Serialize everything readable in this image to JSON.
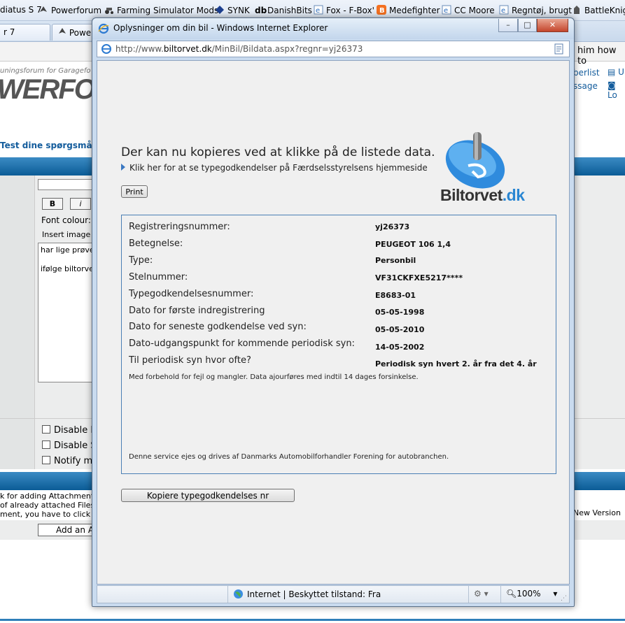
{
  "favorites": [
    {
      "label": "diatus S 7",
      "icon": "page-icon"
    },
    {
      "label": "Powerforum",
      "icon": "forum-icon"
    },
    {
      "label": "Farming Simulator Mods",
      "icon": "tractor-icon"
    },
    {
      "label": "SYNK",
      "icon": "synk-icon"
    },
    {
      "label": "DanishBits",
      "icon": "db-icon"
    },
    {
      "label": "Fox - F-Box'",
      "icon": "ie-icon"
    },
    {
      "label": "Medefighter",
      "icon": "blogger-icon"
    },
    {
      "label": "CC Moore",
      "icon": "ie-icon"
    },
    {
      "label": "Regntøj, brugt",
      "icon": "ie-icon"
    },
    {
      "label": "BattleKnight",
      "icon": "knight-icon"
    }
  ],
  "bg_tabs": [
    {
      "label": "r 7"
    },
    {
      "label": "Powerf"
    }
  ],
  "bg_page": {
    "forum_sub": "uningsforum for Garagefo",
    "logo": "WERFO",
    "memberlist": "berlist",
    "message": "ssage",
    "u_link": "U",
    "lo_link": "Lo",
    "test_link": "Test dine spørgsmål",
    "him_text": "him how to",
    "bold_btn": "B",
    "italic_btn": "i",
    "font_colour": "Font colour:",
    "insert_image": "Insert image",
    "post_line1": "har lige prøve",
    "post_line2": "ifølge biltorve",
    "disable1": "Disable H",
    "disable2": "Disable S",
    "notify": "Notify m",
    "attach1": "k for adding Attachment",
    "attach2": "of already attached Files",
    "attach3": "ment, you have to click",
    "add_btn": "Add an A",
    "new_version": "New Version a"
  },
  "popup": {
    "title": "Oplysninger om din bil - Windows Internet Explorer",
    "url_prefix": "http://www.",
    "url_domain": "biltorvet.dk",
    "url_suffix": "/MinBil/Bildata.aspx?regnr=yj26373",
    "min_btn": "–",
    "max_btn": "□",
    "close_btn": "✕",
    "heading": "Der kan nu kopieres ved at klikke på de listede data.",
    "sublink": "Klik her for at se typegodkendelser på Færdselsstyrelsens hjemmeside",
    "print_label": "Print",
    "logo_main": "Biltorvet",
    "logo_suffix": ".dk",
    "rows": [
      {
        "label": "Registreringsnummer:",
        "value": "yj26373"
      },
      {
        "label": "Betegnelse:",
        "value": "PEUGEOT 106 1,4"
      },
      {
        "label": "Type:",
        "value": "Personbil"
      },
      {
        "label": "Stelnummer:",
        "value": "VF31CKFXE5217****"
      },
      {
        "label": "Typegodkendelsesnummer:",
        "value": "E8683-01"
      },
      {
        "label": "Dato for første indregistrering",
        "value": "05-05-1998"
      },
      {
        "label": "Dato for seneste godkendelse ved syn:",
        "value": "05-05-2010"
      },
      {
        "label": "Dato-udgangspunkt for kommende periodisk syn:",
        "value": "14-05-2002"
      },
      {
        "label": "Til periodisk syn hvor ofte?",
        "value": "Periodisk syn hvert 2. år fra det 4. år"
      }
    ],
    "disclaimer": "Med forbehold for fejl og mangler. Data ajourføres med indtil 14 dages forsinkelse.",
    "footer_note": "Denne service ejes og drives af Danmarks Automobilforhandler Forening for autobranchen.",
    "copy_button": "Kopiere typegodkendelses nr",
    "status_zone": "Internet | Beskyttet tilstand: Fra",
    "zoom": "100%"
  }
}
